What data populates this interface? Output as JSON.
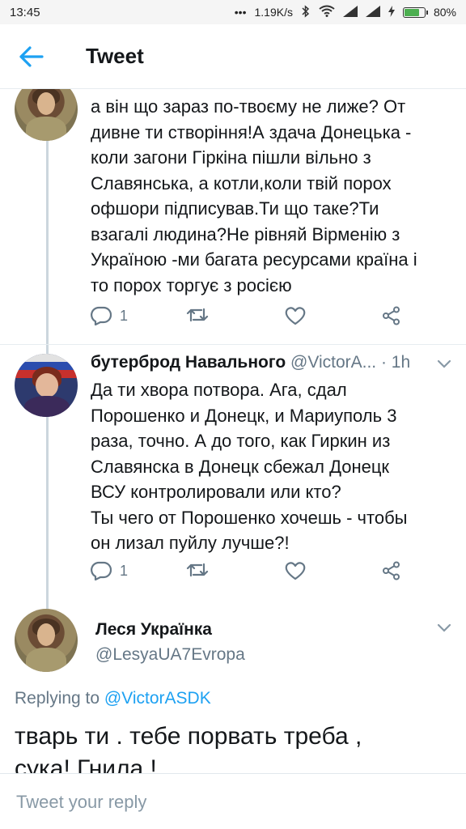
{
  "status_bar": {
    "time": "13:45",
    "dots": "•••",
    "network_speed": "1.19K/s",
    "battery_percent": "80%",
    "battery_level": 0.8
  },
  "header": {
    "title": "Tweet",
    "back_icon": "arrow-left-icon",
    "accent_color": "#1da1f2"
  },
  "tweets": [
    {
      "author_avatar": "lesya-avatar",
      "text_lines": [
        "а він що зараз по-твоєму не лиже? От",
        "дивне ти створіння!А здача  Донецька -",
        "коли загони Гіркіна  пішли вільно з",
        "Славянська, а котли,коли твій порох",
        "офшори підписував.Ти що таке?Ти",
        "взагалі людина?Не рівняй Вірменію з",
        "Україною -ми багата ресурсами  країна і",
        "то порох торгує з росією"
      ],
      "reply_count": "1"
    },
    {
      "author_name": "бутерброд Навального",
      "author_handle": "@VictorA...",
      "time": "· 1h",
      "author_avatar": "navalny-sandwich-avatar",
      "text_lines": [
        "Да ти хвора потвора. Ага, сдал",
        "Порошенко и Донецк, и Мариуполь 3",
        "раза, точно. А до того, как Гиркин из",
        "Славянска в Донецк сбежал Донецк",
        "ВСУ контролировали или кто?",
        "Ты чего от Порошенко хочешь - чтобы",
        "он лизал пуйлу лучше?!"
      ],
      "reply_count": "1"
    }
  ],
  "focus_tweet": {
    "author_name": "Леся Українка",
    "author_handle": "@LesyaUA7Evropa",
    "replying_prefix": "Replying to",
    "replying_to": "@VictorASDK",
    "text_lines": [
      "тварь ти . тебе порвать треба ,",
      "сука! Гнила !"
    ]
  },
  "composer": {
    "placeholder": "Tweet your reply"
  }
}
